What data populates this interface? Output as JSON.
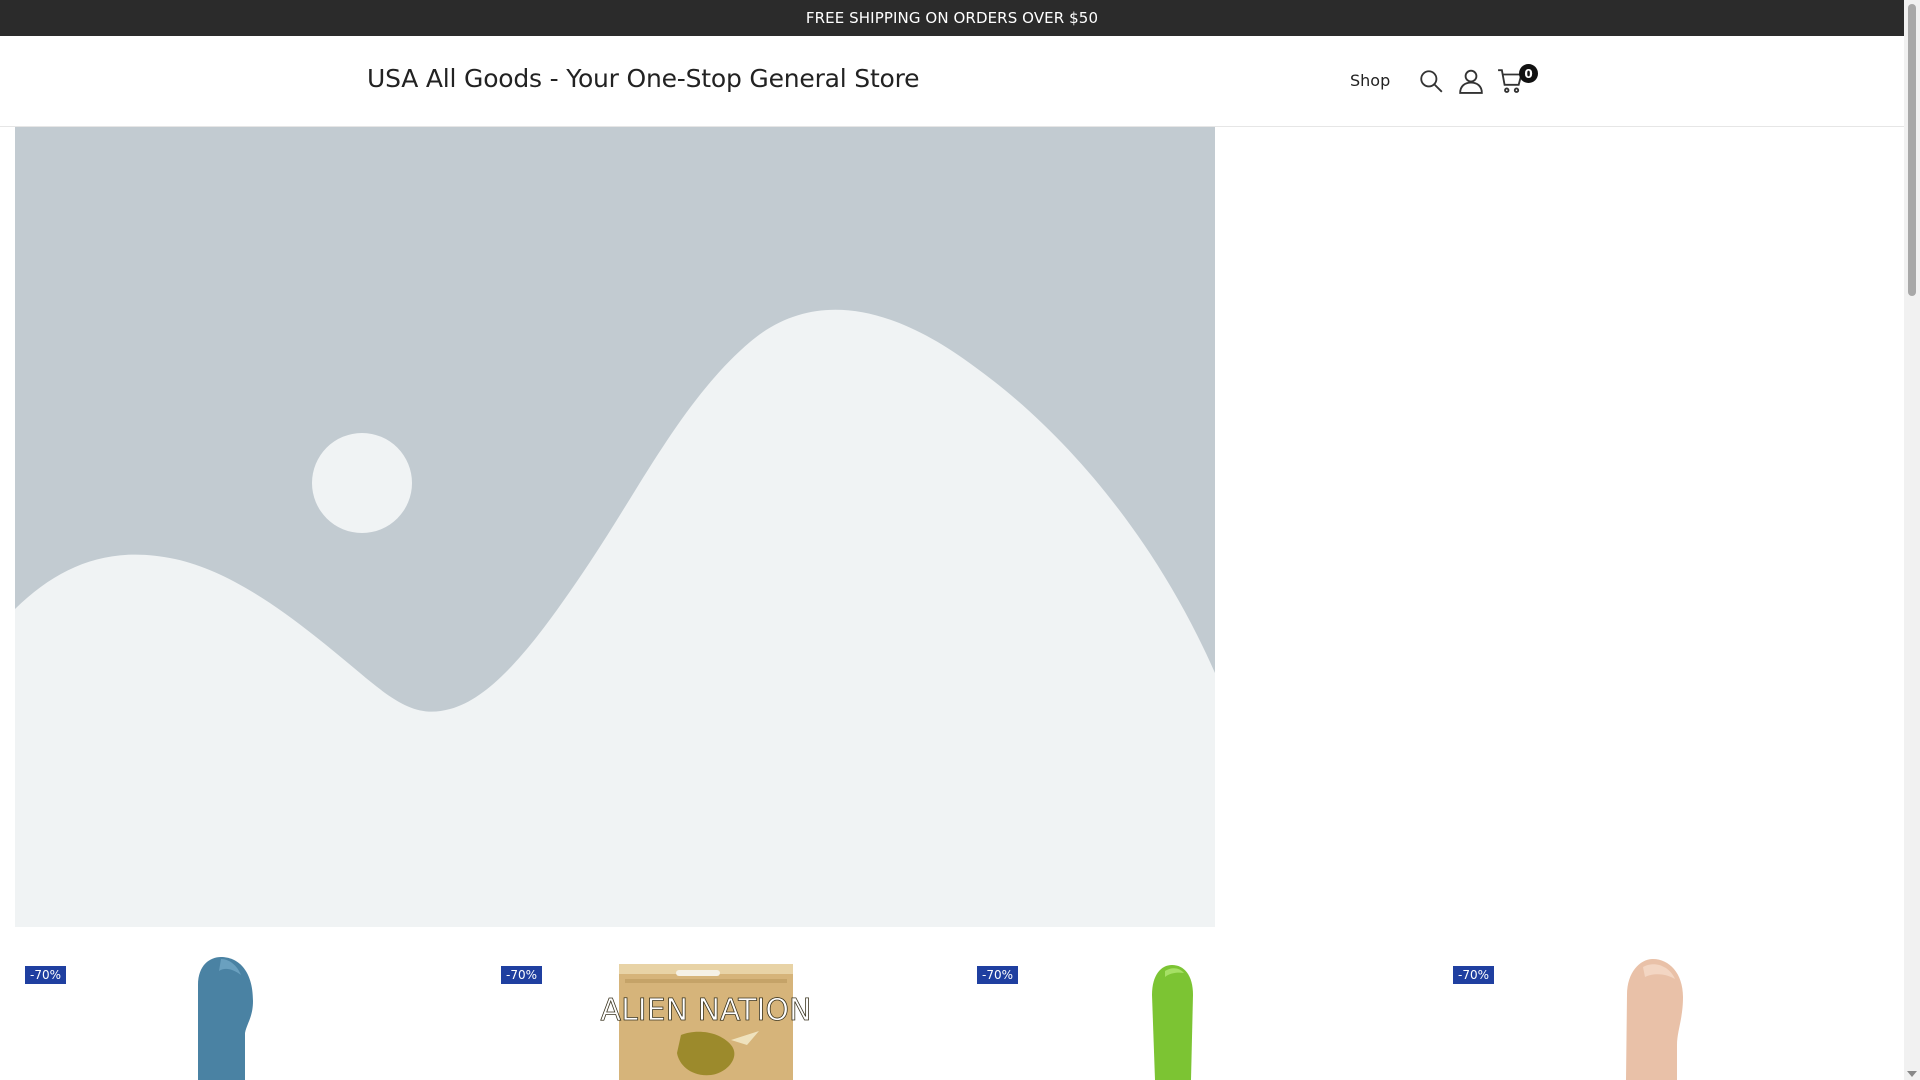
{
  "announcement": {
    "text": "FREE SHIPPING ON ORDERS OVER $50"
  },
  "header": {
    "site_title": "USA All Goods - Your One-Stop General Store",
    "nav": [
      {
        "label": "Shop"
      }
    ],
    "icons": {
      "search": "search-icon",
      "account": "user-icon",
      "cart": "cart-icon"
    },
    "cart_count": "0"
  },
  "hero": {
    "image": "image-placeholder"
  },
  "products": [
    {
      "badge": "-70%",
      "image": "blue-product"
    },
    {
      "badge": "-70%",
      "image": "alien-nation-box",
      "box_text": "ALIEN NATION"
    },
    {
      "badge": "-70%",
      "image": "green-product"
    },
    {
      "badge": "-70%",
      "image": "beige-product"
    }
  ],
  "colors": {
    "announcement_bg": "#2b2b2b",
    "badge_bg": "#1f3fa0",
    "hero_bg": "#c2cbd1",
    "hero_fg": "#f0f3f4"
  }
}
